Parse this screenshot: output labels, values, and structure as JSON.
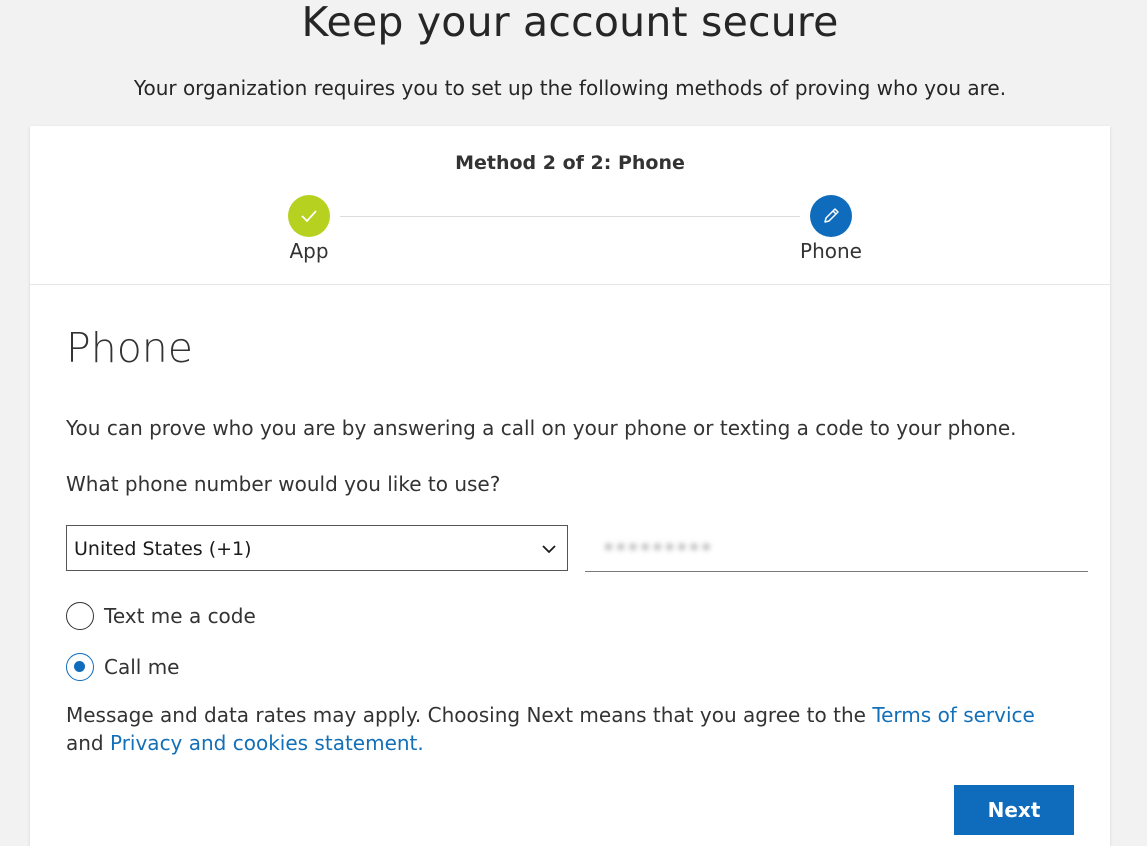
{
  "header": {
    "title": "Keep your account secure",
    "subtitle": "Your organization requires you to set up the following methods of proving who you are."
  },
  "stepper": {
    "title": "Method 2 of 2: Phone",
    "steps": [
      {
        "label": "App",
        "state": "completed",
        "icon": "checkmark-icon",
        "color": "#b6d120"
      },
      {
        "label": "Phone",
        "state": "current",
        "icon": "pencil-icon",
        "color": "#0f6cbd"
      }
    ]
  },
  "form": {
    "heading": "Phone",
    "description": "You can prove who you are by answering a call on your phone or texting a code to your phone.",
    "question": "What phone number would you like to use?",
    "country_select": {
      "value": "United States (+1)"
    },
    "phone_number": {
      "value": "•••••••••",
      "obscured": true
    },
    "options": [
      {
        "label": "Text me a code",
        "checked": false
      },
      {
        "label": "Call me",
        "checked": true
      }
    ],
    "disclaimer": {
      "text_before": "Message and data rates may apply. Choosing Next means that you agree to the ",
      "terms_link": "Terms of service",
      "text_middle": " and ",
      "privacy_link": "Privacy and cookies statement.",
      "link_color": "#1370b8"
    },
    "next_label": "Next"
  },
  "colors": {
    "primary": "#0f6cbd",
    "success": "#b6d120",
    "background": "#f2f2f2"
  }
}
